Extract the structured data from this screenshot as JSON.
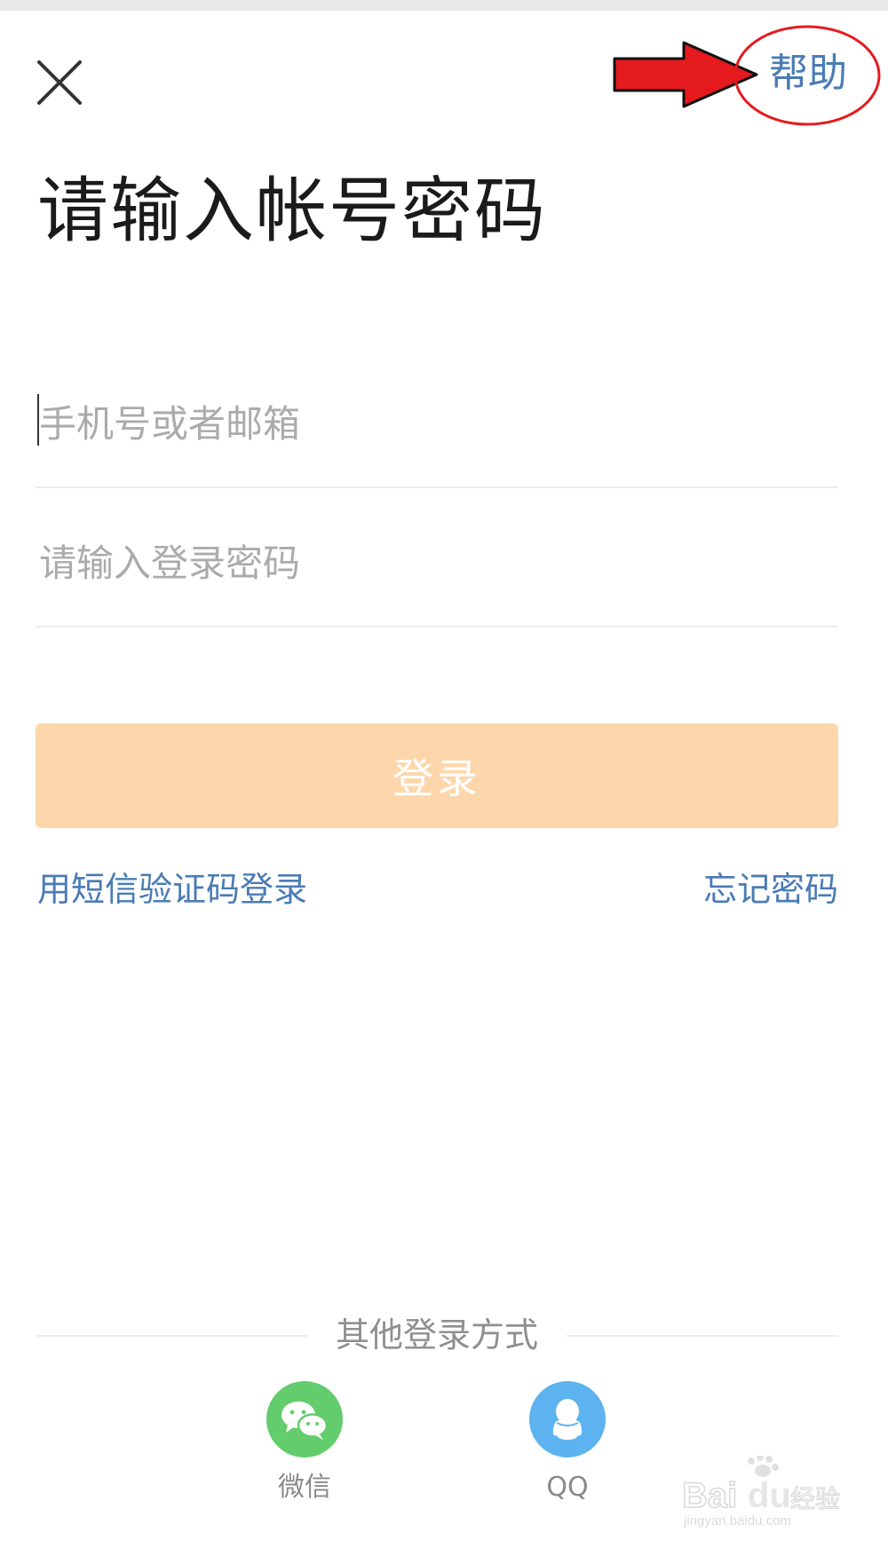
{
  "title": "请输入帐号密码",
  "help_label": "帮助",
  "account_field": {
    "placeholder": "手机号或者邮箱",
    "value": ""
  },
  "password_field": {
    "placeholder": "请输入登录密码",
    "value": ""
  },
  "login_button_label": "登录",
  "sms_login_link": "用短信验证码登录",
  "forgot_password_link": "忘记密码",
  "other_login_label": "其他登录方式",
  "social_logins": [
    {
      "label": "微信",
      "icon": "wechat-icon",
      "color": "#63cc6c"
    },
    {
      "label": "QQ",
      "icon": "qq-icon",
      "color": "#5cb3ef"
    }
  ],
  "watermark_text": "Baidu经验",
  "colors": {
    "link": "#4a7bb5",
    "login_button_disabled": "#fdd7ab",
    "annotation_red": "#e51a1f"
  }
}
